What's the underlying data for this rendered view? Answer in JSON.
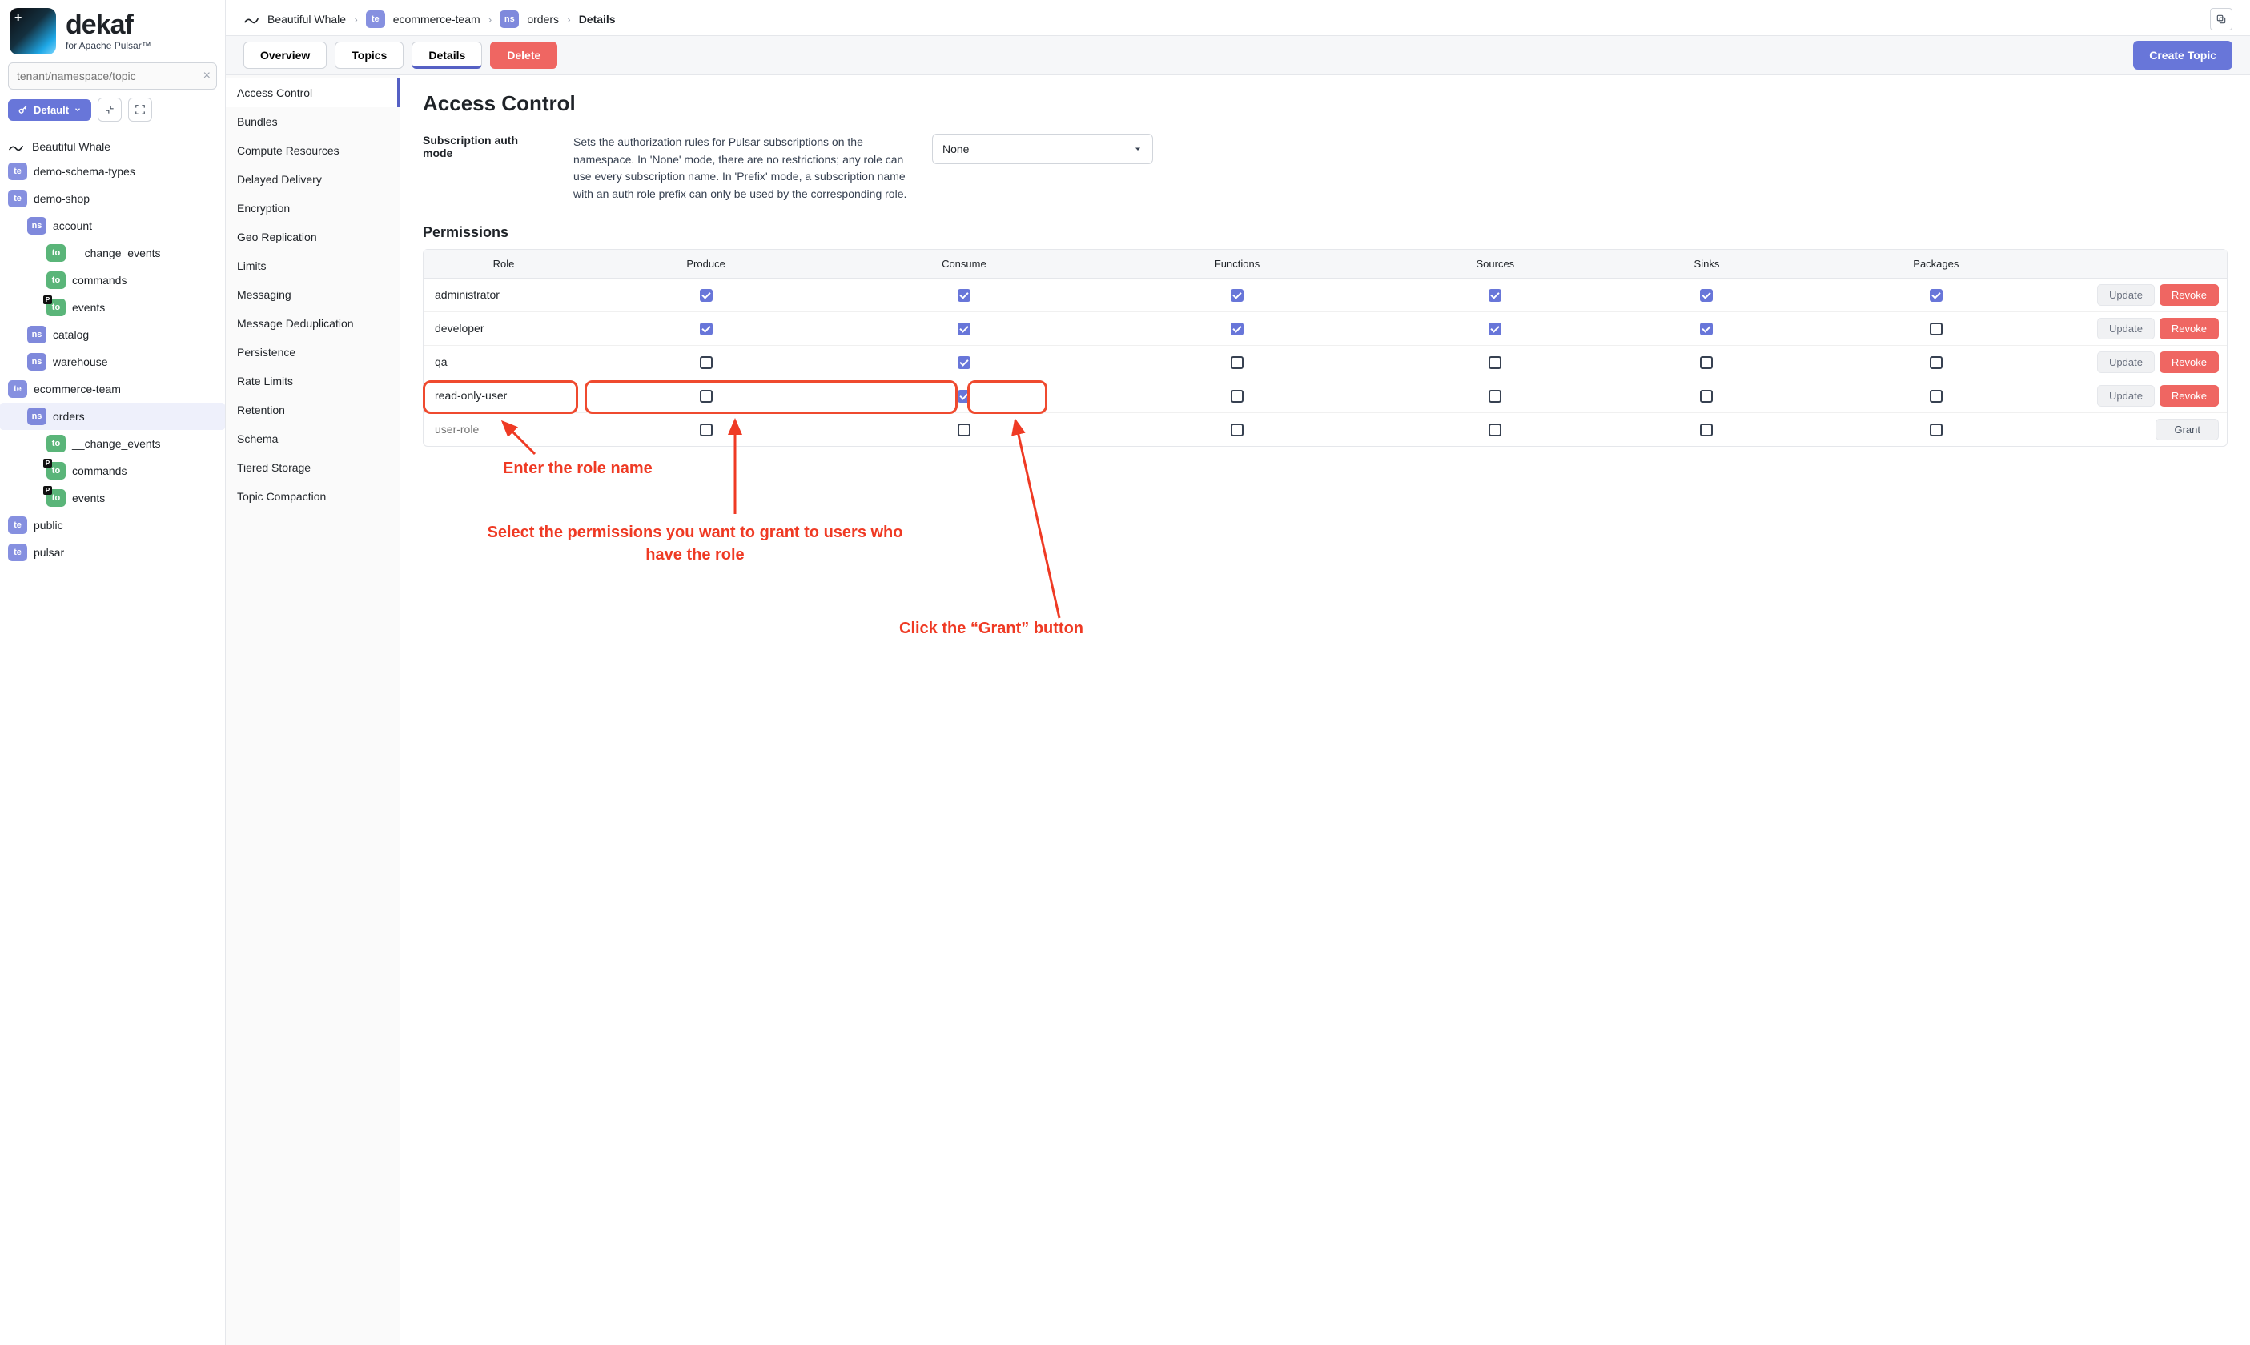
{
  "logo": {
    "name": "dekaf",
    "tagline": "for Apache Pulsar™"
  },
  "search": {
    "placeholder": "tenant/namespace/topic"
  },
  "controls": {
    "default_label": "Default"
  },
  "tree": {
    "cluster": "Beautiful Whale",
    "nodes": [
      {
        "type": "te",
        "label": "demo-schema-types",
        "indent": 0
      },
      {
        "type": "te",
        "label": "demo-shop",
        "indent": 0
      },
      {
        "type": "ns",
        "label": "account",
        "indent": 1
      },
      {
        "type": "to",
        "label": "__change_events",
        "indent": 2
      },
      {
        "type": "to",
        "label": "commands",
        "indent": 2
      },
      {
        "type": "to",
        "label": "events",
        "indent": 2,
        "p": true
      },
      {
        "type": "ns",
        "label": "catalog",
        "indent": 1
      },
      {
        "type": "ns",
        "label": "warehouse",
        "indent": 1
      },
      {
        "type": "te",
        "label": "ecommerce-team",
        "indent": 0
      },
      {
        "type": "ns",
        "label": "orders",
        "indent": 1,
        "selected": true
      },
      {
        "type": "to",
        "label": "__change_events",
        "indent": 2
      },
      {
        "type": "to",
        "label": "commands",
        "indent": 2,
        "p": true
      },
      {
        "type": "to",
        "label": "events",
        "indent": 2,
        "p": true
      },
      {
        "type": "te",
        "label": "public",
        "indent": 0
      },
      {
        "type": "te",
        "label": "pulsar",
        "indent": 0
      }
    ]
  },
  "breadcrumb": {
    "cluster": "Beautiful Whale",
    "tenant_badge": "te",
    "tenant": "ecommerce-team",
    "ns_badge": "ns",
    "namespace": "orders",
    "last": "Details"
  },
  "tabs": {
    "overview": "Overview",
    "topics": "Topics",
    "details": "Details",
    "delete": "Delete"
  },
  "create_topic": "Create Topic",
  "mid_menu": [
    "Access Control",
    "Bundles",
    "Compute Resources",
    "Delayed Delivery",
    "Encryption",
    "Geo Replication",
    "Limits",
    "Messaging",
    "Message Deduplication",
    "Persistence",
    "Rate Limits",
    "Retention",
    "Schema",
    "Tiered Storage",
    "Topic Compaction"
  ],
  "panel": {
    "title": "Access Control",
    "auth_label": "Subscription auth mode",
    "auth_desc": "Sets the authorization rules for Pulsar subscriptions on the namespace. In 'None' mode, there are no restrictions; any role can use every subscription name. In 'Prefix' mode, a subscription name with an auth role prefix can only be used by the corresponding role.",
    "auth_value": "None",
    "perm_title": "Permissions",
    "columns": [
      "Role",
      "Produce",
      "Consume",
      "Functions",
      "Sources",
      "Sinks",
      "Packages"
    ],
    "rows": [
      {
        "role": "administrator",
        "perms": [
          true,
          true,
          true,
          true,
          true,
          true
        ]
      },
      {
        "role": "developer",
        "perms": [
          true,
          true,
          true,
          true,
          true,
          false
        ]
      },
      {
        "role": "qa",
        "perms": [
          false,
          true,
          false,
          false,
          false,
          false
        ]
      },
      {
        "role": "read-only-user",
        "perms": [
          false,
          true,
          false,
          false,
          false,
          false
        ]
      }
    ],
    "new_row_placeholder": "user-role",
    "btn_update": "Update",
    "btn_revoke": "Revoke",
    "btn_grant": "Grant"
  },
  "annotations": {
    "a1": "Enter the role name",
    "a2": "Select the permissions you want to grant to users who have the role",
    "a3": "Click the “Grant” button"
  }
}
